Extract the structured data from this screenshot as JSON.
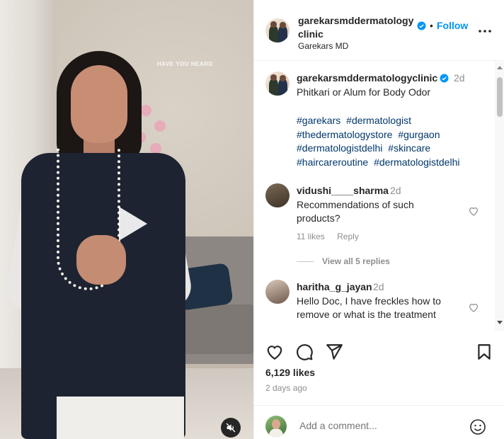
{
  "media": {
    "overlay_text": "HAVE YOU HEARD",
    "icons": {
      "play": "play-icon",
      "mute": "muted-speaker-icon"
    }
  },
  "header": {
    "username": "garekarsmddermatologyclinic",
    "separator": "•",
    "follow_label": "Follow",
    "subtitle": "Garekars MD",
    "icons": {
      "verified": "verified-badge-icon",
      "more": "more-options-icon"
    }
  },
  "caption": {
    "username": "garekarsmddermatologyclinic",
    "time": "2d",
    "text": "Phitkari or Alum for Body Odor",
    "hashtags": [
      "#garekars",
      "#dermatologist",
      "#thedermatologystore",
      "#gurgaon",
      "#dermatologistdelhi",
      "#skincare",
      "#haircareroutine",
      "#dermatologistdelhi"
    ]
  },
  "comments": [
    {
      "username": "vidushi____sharma",
      "time": "2d",
      "text": "Recommendations of such products?",
      "likes": "11 likes",
      "reply_label": "Reply",
      "view_replies": "View all 5 replies"
    },
    {
      "username": "haritha_g_jayan",
      "time": "2d",
      "text": "Hello Doc, I have freckles how to remove or what is the treatment"
    }
  ],
  "actions": {
    "icons": [
      "heart-icon",
      "comment-icon",
      "share-icon",
      "save-icon"
    ]
  },
  "likes_text": "6,129 likes",
  "date_text": "2 days ago",
  "add_comment": {
    "placeholder": "Add a comment...",
    "icon": "emoji-icon"
  },
  "colors": {
    "link_blue": "#0095f6",
    "hashtag_blue": "#00376b",
    "muted_text": "#8e8e8e",
    "text": "#262626"
  }
}
